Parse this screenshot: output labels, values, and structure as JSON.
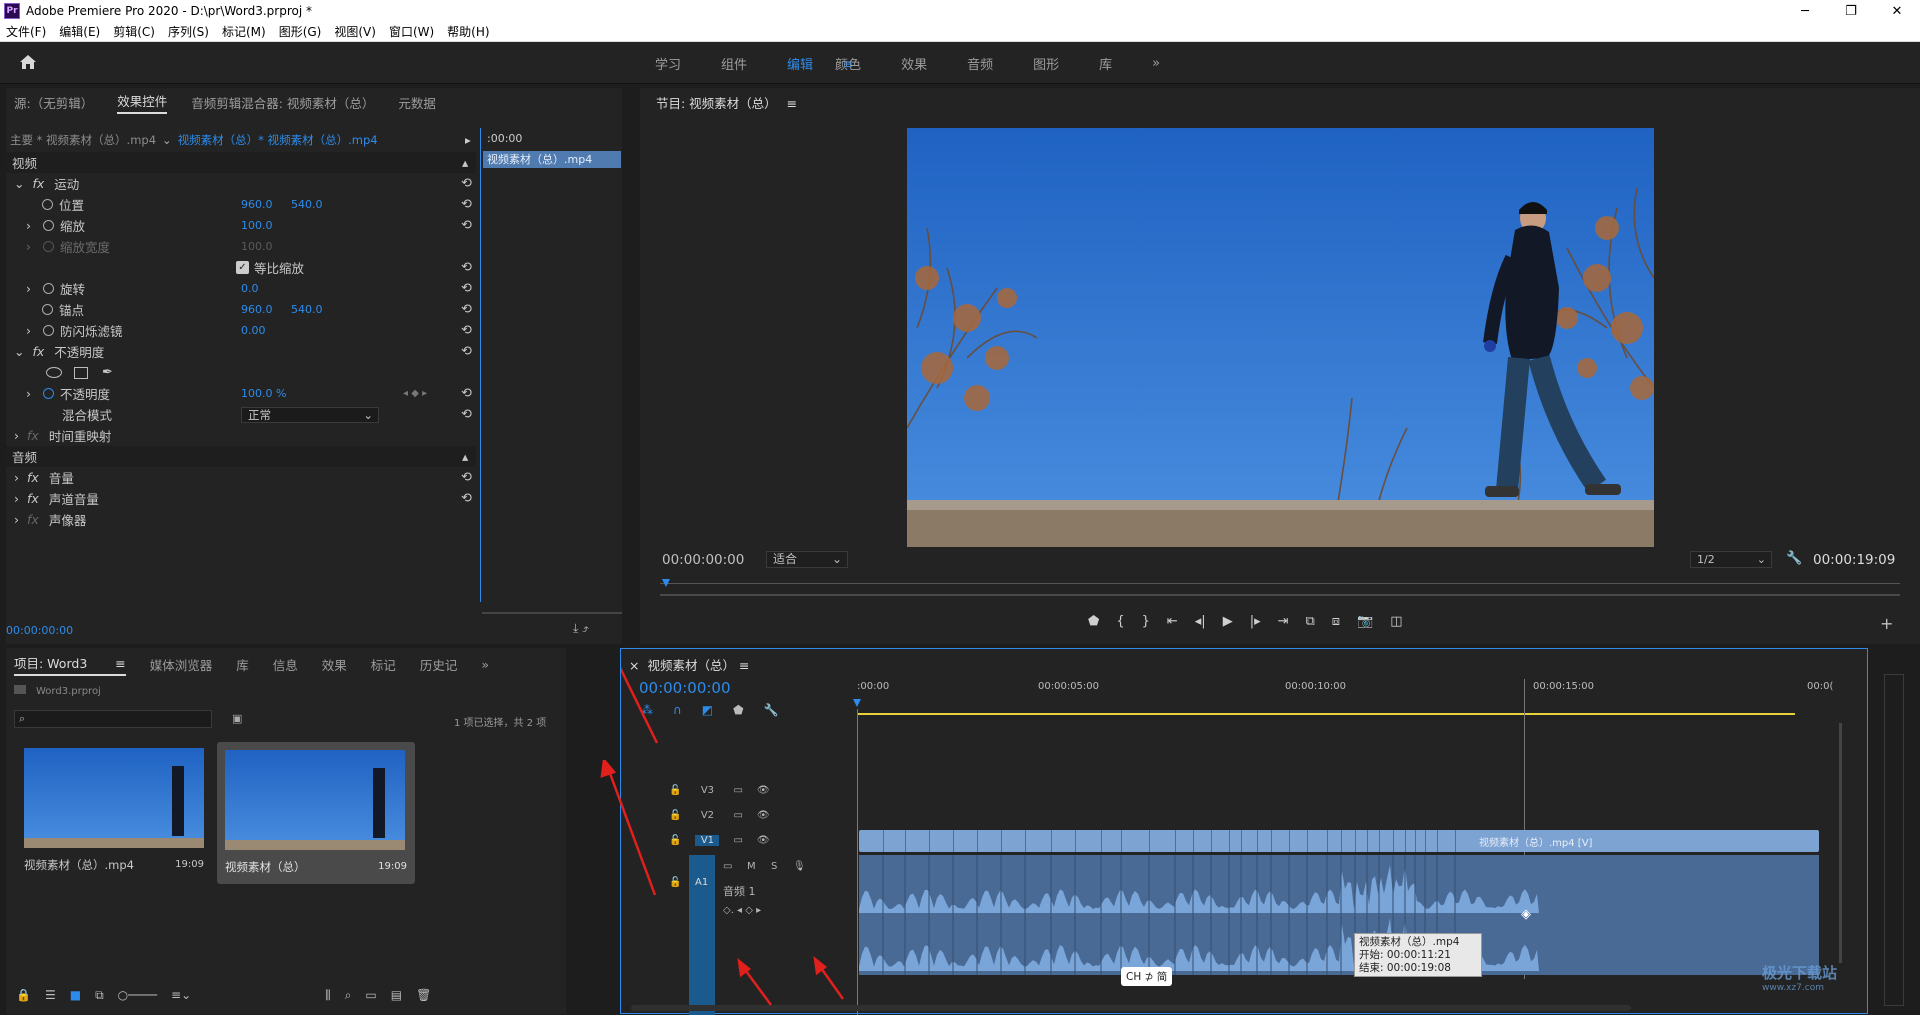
{
  "window": {
    "title": "Adobe Premiere Pro 2020 - D:\\pr\\Word3.prproj *",
    "app_icon": "Pr"
  },
  "menu": [
    "文件(F)",
    "编辑(E)",
    "剪辑(C)",
    "序列(S)",
    "标记(M)",
    "图形(G)",
    "视图(V)",
    "窗口(W)",
    "帮助(H)"
  ],
  "workspaces": [
    "学习",
    "组件",
    "编辑",
    "颜色",
    "效果",
    "音频",
    "图形",
    "库"
  ],
  "workspace_active": "编辑",
  "effect_panel": {
    "tabs": [
      "源:（无剪辑）",
      "效果控件",
      "音频剪辑混合器: 视频素材（总）",
      "元数据"
    ],
    "master_label": "主要 * 视频素材（总）.mp4",
    "clip_label": "视频素材（总）* 视频素材（总）.mp4",
    "time_start": ":00:00",
    "clip_bar": "视频素材（总）.mp4",
    "video_header": "视频",
    "motion": "运动",
    "position_label": "位置",
    "position_x": "960.0",
    "position_y": "540.0",
    "scale_label": "缩放",
    "scale_val": "100.0",
    "scale_width_label": "缩放宽度",
    "scale_width_val": "100.0",
    "uniform_label": "等比缩放",
    "rotation_label": "旋转",
    "rotation_val": "0.0",
    "anchor_label": "锚点",
    "anchor_x": "960.0",
    "anchor_y": "540.0",
    "flicker_label": "防闪烁滤镜",
    "flicker_val": "0.00",
    "opacity_header": "不透明度",
    "opacity_label": "不透明度",
    "opacity_val": "100.0 %",
    "blend_label": "混合模式",
    "blend_val": "正常",
    "time_remap": "时间重映射",
    "audio_header": "音频",
    "volume": "音量",
    "channel_volume": "声道音量",
    "panner": "声像器",
    "timecode": "00:00:00:00"
  },
  "program": {
    "title": "节目: 视频素材（总）",
    "timecode": "00:00:00:00",
    "fit": "适合",
    "resolution": "1/2",
    "duration": "00:00:19:09"
  },
  "project": {
    "tabs": [
      "项目: Word3",
      "媒体浏览器",
      "库",
      "信息",
      "效果",
      "标记",
      "历史记"
    ],
    "file": "Word3.prproj",
    "selection": "1 项已选择，共 2 项",
    "items": [
      {
        "name": "视频素材（总）.mp4",
        "dur": "19:09"
      },
      {
        "name": "视频素材（总）",
        "dur": "19:09"
      }
    ]
  },
  "timeline": {
    "title": "视频素材（总）",
    "timecode": "00:00:00:00",
    "ruler": [
      ":00:00",
      "00:00:05:00",
      "00:00:10:00",
      "00:00:15:00",
      "00:0("
    ],
    "tracks": {
      "v3": "V3",
      "v2": "V2",
      "v1": "V1",
      "a1": "A1",
      "audio_name": "音频 1"
    },
    "clip_name": "视频素材（总）.mp4 [V]",
    "tooltip": {
      "name": "视频素材（总）.mp4",
      "start": "开始: 00:00:11:21",
      "end": "结束: 00:00:19:08"
    },
    "ime": "CH ⊅ 简"
  },
  "watermark": "极光下载站",
  "watermark_url": "www.xz7.com"
}
